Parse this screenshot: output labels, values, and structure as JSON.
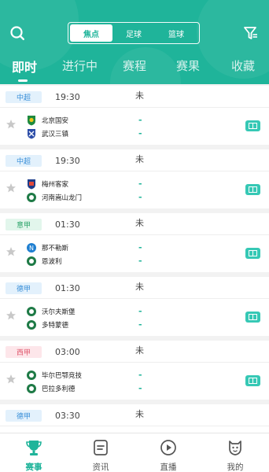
{
  "segment": {
    "options": [
      "焦点",
      "足球",
      "篮球"
    ],
    "active_index": 0
  },
  "tabs": [
    "即时",
    "进行中",
    "赛程",
    "赛果",
    "收藏"
  ],
  "matches": [
    {
      "league": "中超",
      "league_color": "blue",
      "time": "19:30",
      "status": "未",
      "home": "北京国安",
      "away": "武汉三镇",
      "home_score": "-",
      "away_score": "-",
      "live_tag": true
    },
    {
      "league": "中超",
      "league_color": "blue",
      "time": "19:30",
      "status": "未",
      "home": "梅州客家",
      "away": "河南嵩山龙门",
      "home_score": "-",
      "away_score": "-",
      "live_tag": true
    },
    {
      "league": "意甲",
      "league_color": "green",
      "time": "01:30",
      "status": "未",
      "home": "那不勒斯",
      "away": "恩波利",
      "home_score": "-",
      "away_score": "-",
      "live_tag": true
    },
    {
      "league": "德甲",
      "league_color": "blue",
      "time": "01:30",
      "status": "未",
      "home": "沃尔夫斯堡",
      "away": "多特蒙德",
      "home_score": "-",
      "away_score": "-",
      "live_tag": true
    },
    {
      "league": "西甲",
      "league_color": "red",
      "time": "03:00",
      "status": "未",
      "home": "毕尔巴鄂竞技",
      "away": "巴拉多利德",
      "home_score": "-",
      "away_score": "-",
      "live_tag": true
    },
    {
      "league": "德甲",
      "league_color": "blue",
      "time": "03:30",
      "status": "未",
      "home": "",
      "away": "",
      "home_score": "",
      "away_score": "",
      "live_tag": false
    }
  ],
  "bottom_nav": [
    {
      "label": "赛事",
      "icon": "trophy-icon",
      "active": true
    },
    {
      "label": "资讯",
      "icon": "news-icon",
      "active": false
    },
    {
      "label": "直播",
      "icon": "play-icon",
      "active": false
    },
    {
      "label": "我的",
      "icon": "profile-icon",
      "active": false
    }
  ],
  "colors": {
    "brand": "#1fb49a",
    "league_blue": "#3a8fd8",
    "league_green": "#2aa368",
    "league_red": "#e05a6f",
    "live_tag": "#36c8b5"
  }
}
